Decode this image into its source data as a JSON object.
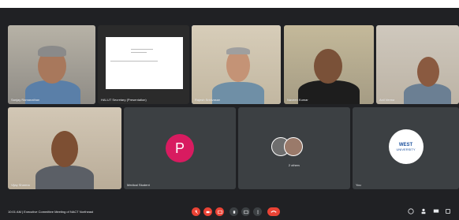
{
  "participants": [
    {
      "name": "Sanjay Ramanathan",
      "type": "video"
    },
    {
      "name": "HAI-UT Secretary (Presentation)",
      "type": "presentation"
    },
    {
      "name": "Rajesh Srinivasan",
      "type": "video",
      "active": true
    },
    {
      "name": "Naveen Kumar",
      "type": "video"
    },
    {
      "name": "Anil Verma",
      "type": "video"
    },
    {
      "name": "Vijay Sharma",
      "type": "video"
    },
    {
      "name": "Medical Student",
      "type": "avatar",
      "initial": "P"
    },
    {
      "name": "2 others",
      "type": "group"
    },
    {
      "name": "You",
      "type": "logo",
      "logo_text": "WEST",
      "logo_subtext": "UNIVERSITY"
    }
  ],
  "toolbar": {
    "meeting_title": "10:01 AM | Executive Committee Meeting of NACT Northeast",
    "buttons": [
      "mic-off-icon",
      "camera-off-icon",
      "captions-icon",
      "raise-hand-icon",
      "present-icon",
      "more-icon"
    ],
    "end_call": "end-call-icon",
    "right_icons": [
      "info-icon",
      "people-icon",
      "chat-icon",
      "activities-icon"
    ]
  },
  "colors": {
    "accent": "#8ab4f8",
    "end": "#ea4335",
    "avatar": "#d81b60"
  }
}
